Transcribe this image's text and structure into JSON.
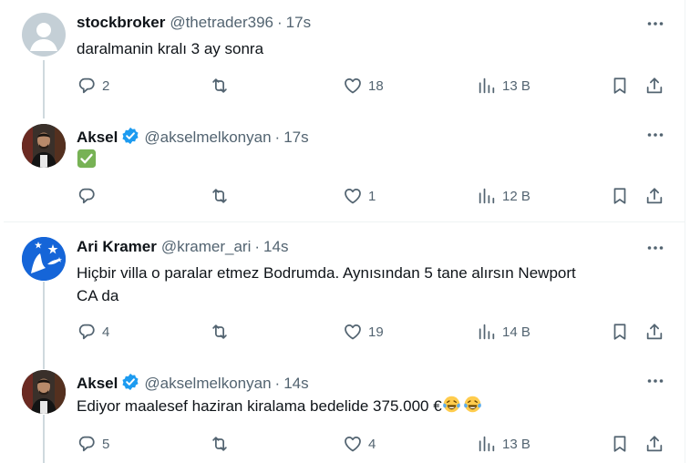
{
  "tweets": [
    {
      "name": "stockbroker",
      "handle": "@thetrader396",
      "separator": "·",
      "time": "17s",
      "text": "daralmanin kralı 3 ay sonra",
      "replies": "2",
      "retweets": "",
      "likes": "18",
      "views": "13 B",
      "avatar": "default-avatar"
    },
    {
      "name": "Aksel",
      "handle": "@akselmelkonyan",
      "separator": "·",
      "time": "17s",
      "text": "",
      "emoji": "check-mark-button-emoji",
      "replies": "",
      "retweets": "",
      "likes": "1",
      "views": "12 B",
      "verified": true
    },
    {
      "name": "Ari Kramer",
      "handle": "@kramer_ari",
      "separator": "·",
      "time": "14s",
      "text_line1": "Hiçbir villa o paralar etmez Bodrumda. Aynısından 5 tane alırsın Newport",
      "text_line2": "CA da",
      "replies": "4",
      "retweets": "",
      "likes": "19",
      "views": "14 B"
    },
    {
      "name": "Aksel",
      "handle": "@akselmelkonyan",
      "separator": "·",
      "time": "14s",
      "text": "Ediyor maalesef haziran kiralama bedelide 375.000 €",
      "emoji": "tears-of-joy-emoji",
      "replies": "5",
      "retweets": "",
      "likes": "4",
      "views": "13 B",
      "verified": true
    }
  ],
  "colors": {
    "text": "#0f1419",
    "secondary": "#536471",
    "verified": "#1d9bf0",
    "thread_line": "#cfd9de",
    "divider": "#eff3f4",
    "check_emoji": "#77b255",
    "default_avatar": "#c4cfd6"
  },
  "icons": [
    "reply-icon",
    "retweet-icon",
    "like-icon",
    "views-icon",
    "bookmark-icon",
    "share-icon",
    "more-icon",
    "verified-icon"
  ]
}
